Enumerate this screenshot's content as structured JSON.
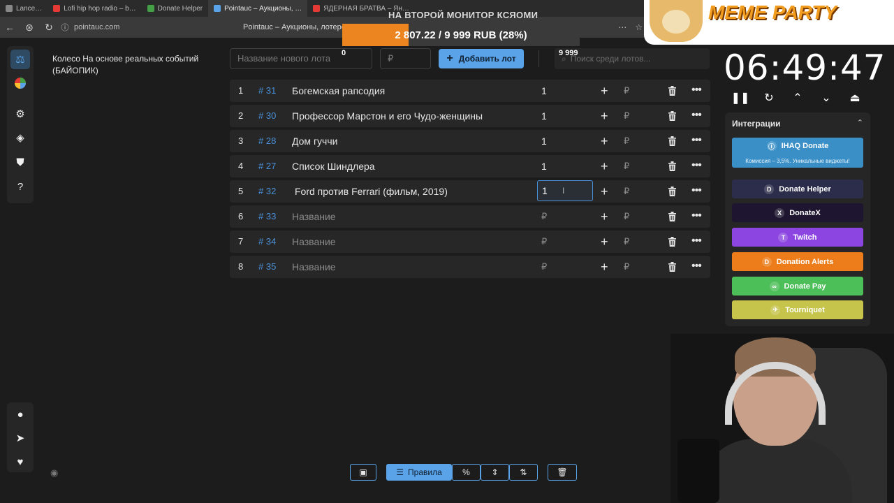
{
  "browser": {
    "tabs": [
      {
        "label": "Lance…",
        "color": "#888888"
      },
      {
        "label": "Lofi hip hop radio – b…",
        "color": "#e53935"
      },
      {
        "label": "Donate Helper",
        "color": "#43a047"
      },
      {
        "label": "Pointauc – Аукционы, …",
        "color": "#5aa3e8",
        "active": true
      },
      {
        "label": "ЯДЕРНАЯ БРАТВА – Ян…",
        "color": "#e53935"
      }
    ],
    "url": "pointauc.com",
    "page_title": "Pointauc – Аукционы, лотереи и…"
  },
  "overlay": {
    "caption": "НА ВТОРОЙ МОНИТОР КСЯОМИ",
    "goal_text": "2 807.22 / 9 999 RUB (28%)",
    "goal_fraction": 0.28,
    "goal_color": "#ec8420",
    "meme_title": "MEME PARTY"
  },
  "wheel": {
    "title": "Колесо На основе реальных событий (БАЙОПИК)"
  },
  "toolbar": {
    "lot_placeholder": "Название нового лота",
    "zero_value": "0",
    "price_placeholder": "₽",
    "add_label": "Добавить лот",
    "search_placeholder": "Поиск среди лотов...",
    "max_value": "9 999"
  },
  "lots": [
    {
      "num": "1",
      "id": "# 31",
      "name": "Богемская рапсодия",
      "amount": "1",
      "placeholder": false
    },
    {
      "num": "2",
      "id": "# 30",
      "name": "Профессор Марстон и его Чудо-женщины",
      "amount": "1",
      "placeholder": false
    },
    {
      "num": "3",
      "id": "# 28",
      "name": "Дом гуччи",
      "amount": "1",
      "placeholder": false
    },
    {
      "num": "4",
      "id": "# 27",
      "name": "Список Шиндлера",
      "amount": "1",
      "placeholder": false
    },
    {
      "num": "5",
      "id": "# 32",
      "name": "Ford против Ferrari (фильм, 2019)",
      "amount": "1",
      "placeholder": false,
      "editing": true
    },
    {
      "num": "6",
      "id": "# 33",
      "name": "Название",
      "amount": "₽",
      "placeholder": true
    },
    {
      "num": "7",
      "id": "# 34",
      "name": "Название",
      "amount": "₽",
      "placeholder": true
    },
    {
      "num": "8",
      "id": "# 35",
      "name": "Название",
      "amount": "₽",
      "placeholder": true
    }
  ],
  "row_icons": {
    "plus": "+",
    "rub": "₽",
    "more": "•••"
  },
  "timer": {
    "value": "06:49:47"
  },
  "integrations": {
    "title": "Интеграции",
    "services": [
      {
        "name": "IHAQ Donate",
        "sub": "Комиссия – 3,5%. Уникальные виджеты!",
        "bg": "#3a8fc7",
        "icon": "Ⓘ"
      },
      {
        "name": "Donate Helper",
        "bg": "#2b2d4a",
        "icon": "D"
      },
      {
        "name": "DonateX",
        "bg": "#1e1630",
        "icon": "X"
      },
      {
        "name": "Twitch",
        "bg": "#8c45e0",
        "icon": "T"
      },
      {
        "name": "Donation Alerts",
        "bg": "#ec7d1a",
        "icon": "D"
      },
      {
        "name": "Donate Pay",
        "bg": "#4cbf58",
        "icon": "∞"
      },
      {
        "name": "Tourniquet",
        "bg": "#c6c44a",
        "icon": "✈"
      }
    ]
  },
  "bottom": {
    "rules_label": "Правила",
    "percent_label": "%"
  }
}
